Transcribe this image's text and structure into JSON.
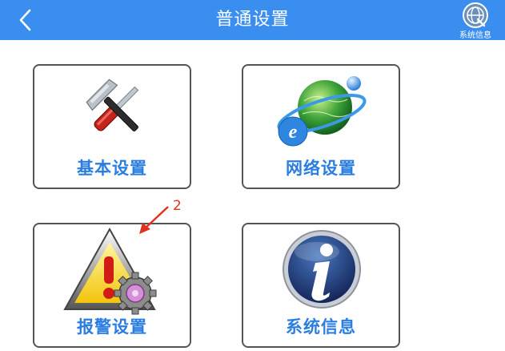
{
  "header": {
    "title": "普通设置",
    "back_icon": "chevron-left-icon",
    "sysinfo_label": "系统信息",
    "sysinfo_icon": "globe-icon",
    "bg_color": "#3a8ef0"
  },
  "cards": [
    {
      "label": "基本设置",
      "icon": "tools-icon"
    },
    {
      "label": "网络设置",
      "icon": "internet-globe-icon"
    },
    {
      "label": "报警设置",
      "icon": "alarm-warning-icon"
    },
    {
      "label": "系统信息",
      "icon": "info-icon"
    }
  ],
  "annotation": {
    "number": "2",
    "color": "#e03020"
  },
  "colors": {
    "label": "#2a7de1",
    "card_border": "#555555"
  }
}
